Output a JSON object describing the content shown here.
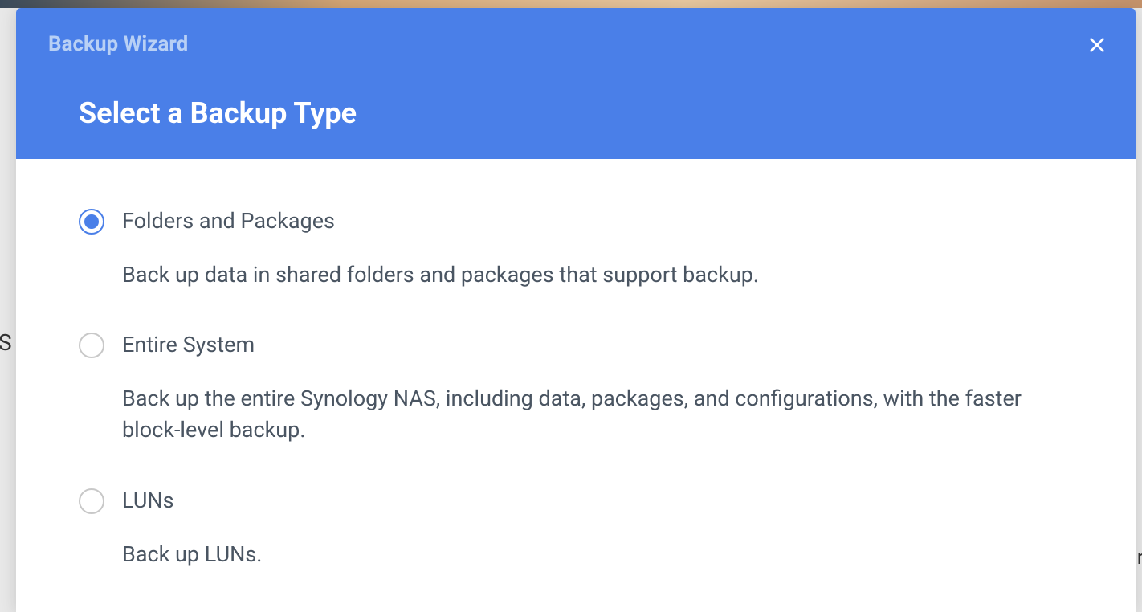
{
  "header": {
    "wizard_label": "Backup Wizard",
    "title": "Select a Backup Type"
  },
  "options": [
    {
      "label": "Folders and Packages",
      "description": "Back up data in shared folders and packages that support backup.",
      "selected": true
    },
    {
      "label": "Entire System",
      "description": "Back up the entire Synology NAS, including data, packages, and configurations, with the faster block-level backup.",
      "selected": false
    },
    {
      "label": "LUNs",
      "description": "Back up LUNs.",
      "selected": false
    }
  ]
}
